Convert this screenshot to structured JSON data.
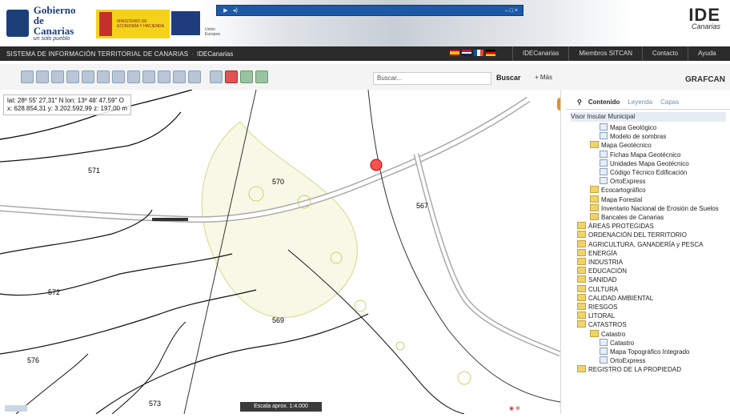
{
  "header": {
    "gobierno_title": "Gobierno",
    "gobierno_sub": "de Canarias",
    "gobierno_tagline": "un solo pueblo",
    "spain_text": "MINISTERIO DE ECONOMÍA Y HACIENDA",
    "feder_text": "Unión Europea",
    "media_title": "",
    "ide_logo": "IDE",
    "ide_sub": "Canarias"
  },
  "navbar": {
    "system": "SISTEMA DE INFORMACIÓN TERRITORIAL DE CANARIAS",
    "sep": "·",
    "brand": "IDECanarias",
    "links": [
      "IDECanarias",
      "Miembros SITCAN",
      "Contacto",
      "Ayuda"
    ]
  },
  "toolbar": {
    "search_placeholder": "Buscar...",
    "search_button": "Buscar",
    "more_button": "+ Más",
    "grafcan": "GRAFCAN"
  },
  "map": {
    "coords_line1": "lat: 28º 55' 27,31\" N  lon: 13º 48' 47,59\" O",
    "coords_line2": "x: 628.854,31  y: 3.202.592,99  z: 197,00 m",
    "scale": "Escala aprox. 1:4.000",
    "labels": [
      "571",
      "570",
      "572",
      "569",
      "576",
      "573",
      "567"
    ]
  },
  "panel": {
    "tabs": [
      "Contenido",
      "Leyenda",
      "Capas"
    ],
    "subheader": "Visor Insular Municipal",
    "tree": [
      {
        "level": "lvl3",
        "type": "layer",
        "label": "Mapa Geológico"
      },
      {
        "level": "lvl3",
        "type": "layer",
        "label": "Modelo de sombras"
      },
      {
        "level": "lvl2",
        "type": "folder",
        "label": "Mapa Geotécnico"
      },
      {
        "level": "lvl3",
        "type": "layer",
        "label": "Fichas Mapa Geotécnico"
      },
      {
        "level": "lvl3",
        "type": "layer",
        "label": "Unidades Mapa Geotécnico"
      },
      {
        "level": "lvl3",
        "type": "layer",
        "label": "Código Técnico Edificación"
      },
      {
        "level": "lvl3",
        "type": "layer",
        "label": "OrtoExpress"
      },
      {
        "level": "lvl2",
        "type": "folder",
        "label": "Ecocartográfico"
      },
      {
        "level": "lvl2",
        "type": "folder",
        "label": "Mapa Forestal"
      },
      {
        "level": "lvl2",
        "type": "folder",
        "label": "Inventario Nacional de Erosión de Suelos"
      },
      {
        "level": "lvl2",
        "type": "folder",
        "label": "Bancales de Canarias"
      },
      {
        "level": "lvl1",
        "type": "folder",
        "label": "ÁREAS PROTEGIDAS"
      },
      {
        "level": "lvl1",
        "type": "folder",
        "label": "ORDENACIÓN DEL TERRITORIO"
      },
      {
        "level": "lvl1",
        "type": "folder",
        "label": "AGRICULTURA, GANADERÍA y PESCA"
      },
      {
        "level": "lvl1",
        "type": "folder",
        "label": "ENERGÍA"
      },
      {
        "level": "lvl1",
        "type": "folder",
        "label": "INDUSTRIA"
      },
      {
        "level": "lvl1",
        "type": "folder",
        "label": "EDUCACIÓN"
      },
      {
        "level": "lvl1",
        "type": "folder",
        "label": "SANIDAD"
      },
      {
        "level": "lvl1",
        "type": "folder",
        "label": "CULTURA"
      },
      {
        "level": "lvl1",
        "type": "folder",
        "label": "CALIDAD AMBIENTAL"
      },
      {
        "level": "lvl1",
        "type": "folder",
        "label": "RIESGOS"
      },
      {
        "level": "lvl1",
        "type": "folder",
        "label": "LITORAL"
      },
      {
        "level": "lvl1",
        "type": "folder",
        "label": "CATASTROS"
      },
      {
        "level": "lvl2",
        "type": "folder",
        "label": "Catastro"
      },
      {
        "level": "lvl3",
        "type": "layer",
        "label": "Catastro"
      },
      {
        "level": "lvl3",
        "type": "layer",
        "label": "Mapa Topográfico Integrado"
      },
      {
        "level": "lvl3",
        "type": "layer",
        "label": "OrtoExpress"
      },
      {
        "level": "lvl1",
        "type": "folder",
        "label": "REGISTRO DE LA PROPIEDAD"
      }
    ]
  }
}
